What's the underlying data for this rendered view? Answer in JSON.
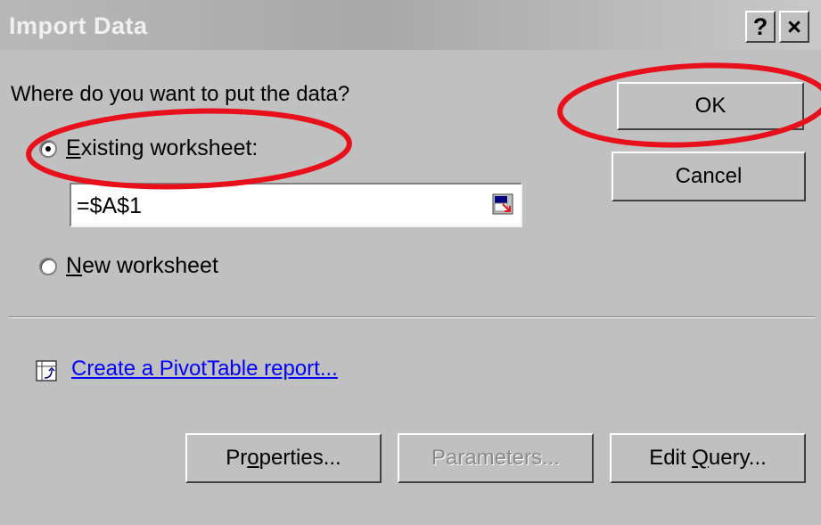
{
  "window": {
    "title": "Import Data",
    "help_label": "?",
    "close_label": "×"
  },
  "prompt": "Where do you want to put the data?",
  "options": {
    "existing": {
      "label_ul": "E",
      "label_rest": "xisting worksheet:",
      "checked": true
    },
    "new": {
      "label_ul": "N",
      "label_rest": "ew worksheet",
      "checked": false
    }
  },
  "reference_field": {
    "value": "=$A$1"
  },
  "pivot_link": "Create a PivotTable report...",
  "buttons": {
    "ok": "OK",
    "cancel": "Cancel",
    "properties_pre": "Pr",
    "properties_ul": "o",
    "properties_post": "perties...",
    "parameters": "Parameters...",
    "edit_query_pre": "Edit ",
    "edit_query_ul": "Q",
    "edit_query_post": "uery..."
  },
  "colors": {
    "dialog_bg": "#c0c0c0",
    "annotation_red": "#e8101a",
    "link_blue": "#0000ff"
  },
  "icons": {
    "collapse": "collapse-dialog-icon",
    "pivot": "pivot-table-icon"
  }
}
